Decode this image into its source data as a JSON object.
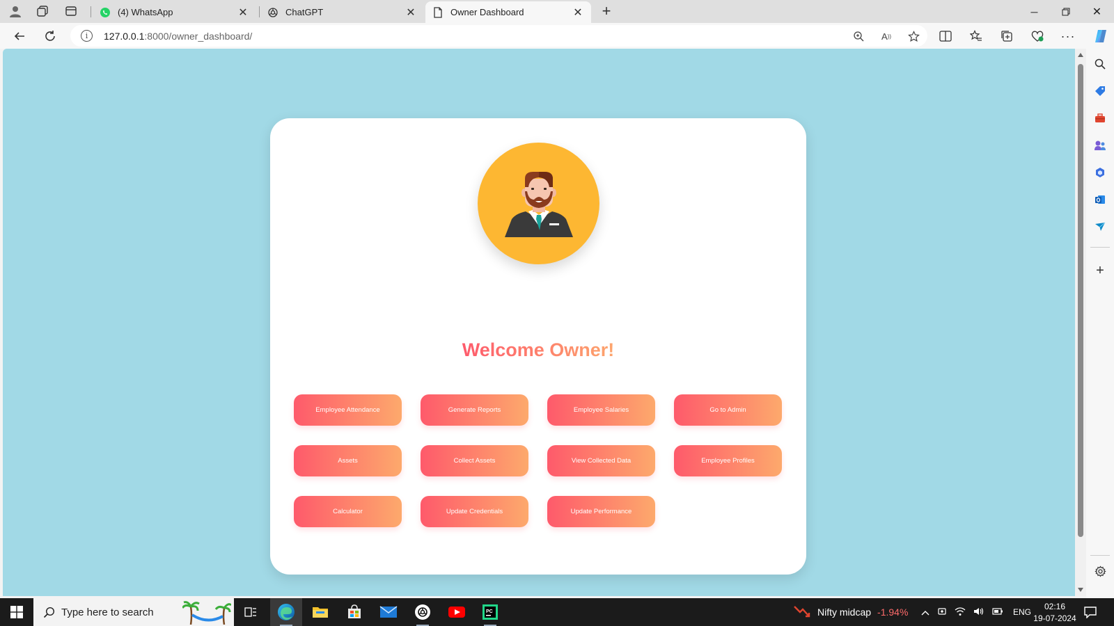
{
  "browser": {
    "tabs": [
      {
        "title": "(4) WhatsApp",
        "favicon": "whatsapp-icon",
        "active": false
      },
      {
        "title": "ChatGPT",
        "favicon": "chatgpt-icon",
        "active": false
      },
      {
        "title": "Owner Dashboard",
        "favicon": "page-icon",
        "active": true
      }
    ],
    "address": {
      "host": "127.0.0.1",
      "path": ":8000/owner_dashboard/"
    }
  },
  "page": {
    "welcome": "Welcome Owner!",
    "avatar": "businessman-avatar-icon",
    "buttons": [
      "Employee Attendance",
      "Generate Reports",
      "Employee Salaries",
      "Go to Admin",
      "Assets",
      "Collect Assets",
      "View Collected Data",
      "Employee Profiles",
      "Calculator",
      "Update Credentials",
      "Update Performance"
    ],
    "colors": {
      "background": "#a1d9e6",
      "gradient_start": "#fe5a6b",
      "gradient_end": "#fda96c",
      "avatar_bg": "#fdb732"
    }
  },
  "taskbar": {
    "search_placeholder": "Type here to search",
    "stock": {
      "name": "Nifty midcap",
      "change": "-1.94%"
    },
    "language": "ENG",
    "time": "02:16",
    "date": "19-07-2024"
  }
}
